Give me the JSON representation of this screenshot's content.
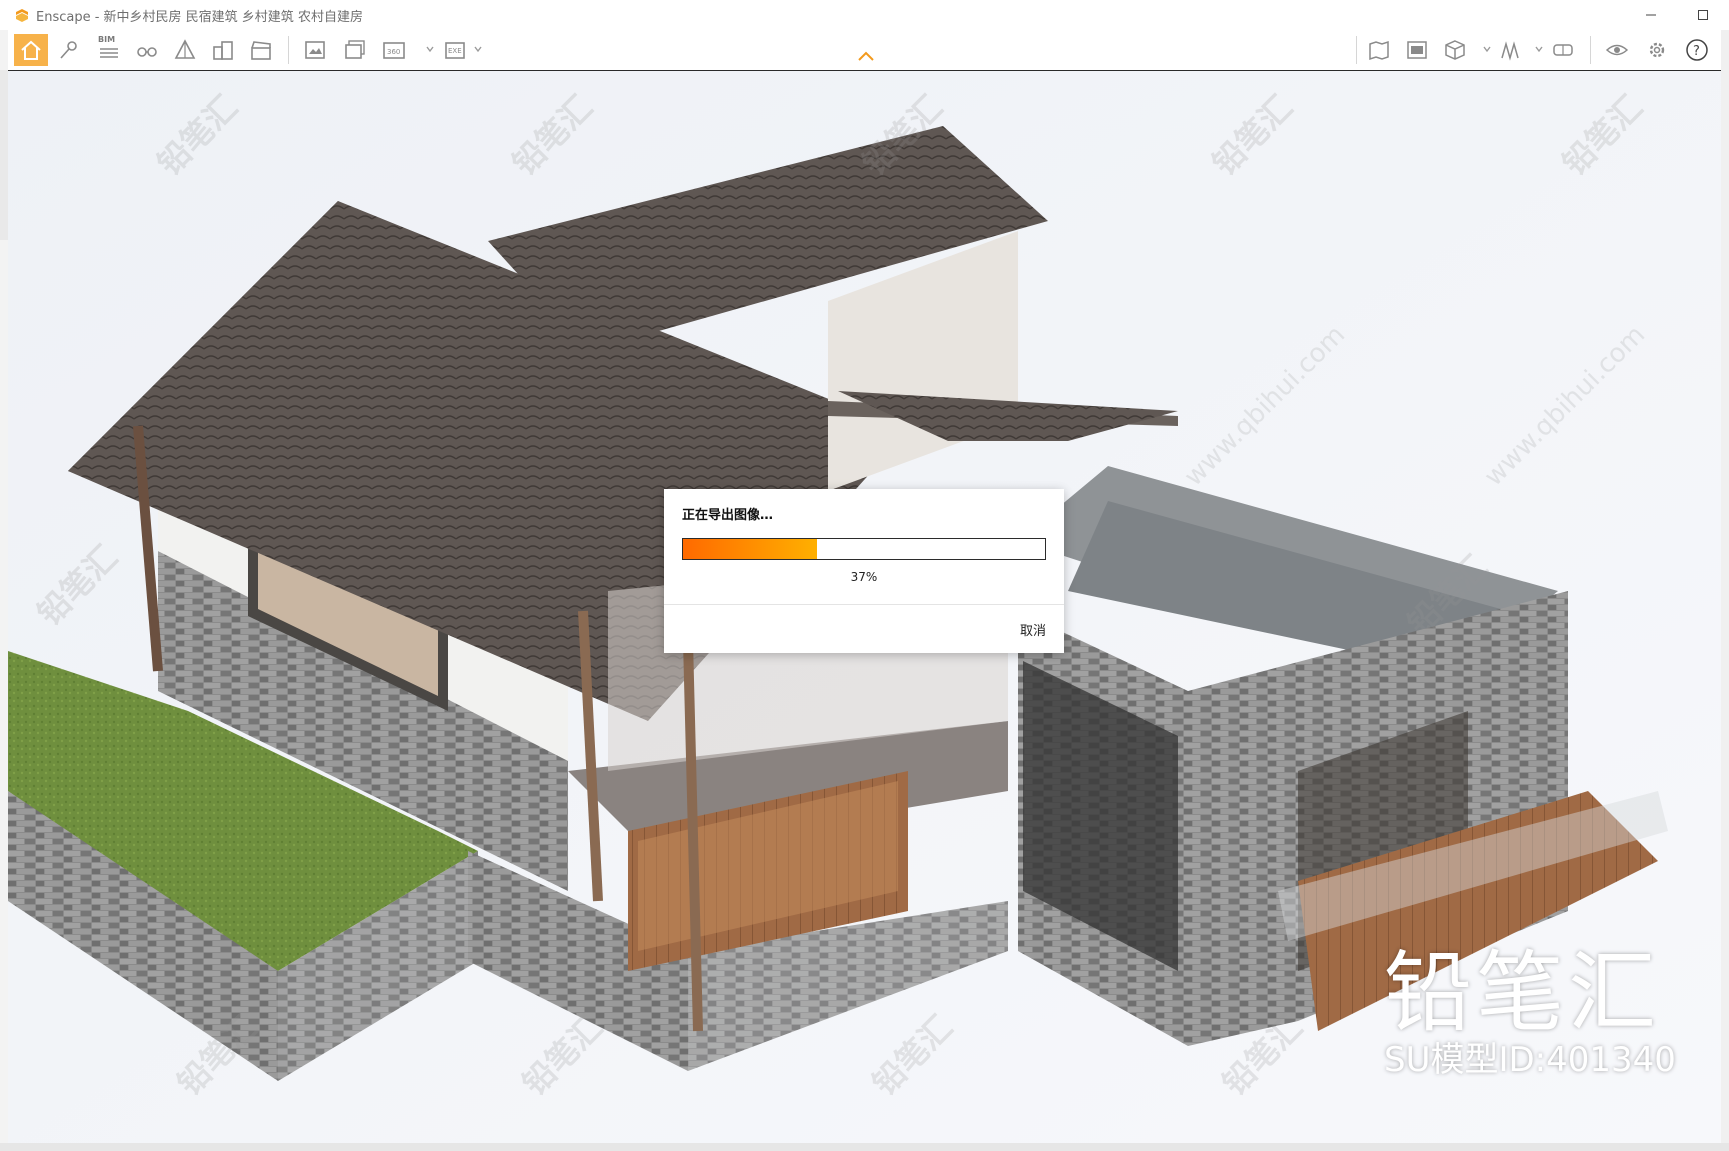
{
  "window": {
    "title": "Enscape - 新中乡村民房 民宿建筑 乡村建筑 农村自建房",
    "logo_icon": "enscape-logo-icon",
    "controls": [
      "minimize-icon",
      "maximize-icon"
    ]
  },
  "toolbar": {
    "accent_color": "#f7b24a",
    "left_icons": [
      "home-icon",
      "pin-icon",
      "bim-icon",
      "binoculars-icon",
      "grid-icon",
      "buildings-icon",
      "clapper-icon",
      "screenshot-icon",
      "batch-render-icon",
      "panorama-360-icon",
      "exe-export-icon"
    ],
    "bim_label": "BIM",
    "right_icons": [
      "map-icon",
      "asset-library-icon",
      "cube-icon",
      "atlas-icon",
      "vr-headset-icon",
      "eye-icon",
      "gear-icon",
      "help-icon"
    ]
  },
  "dialog": {
    "title": "正在导出图像…",
    "progress_percent": 37,
    "progress_label": "37%",
    "cancel_label": "取消",
    "bar_colors": [
      "#ff6a00",
      "#ffb000"
    ]
  },
  "watermarks": {
    "brand": "铅笔汇",
    "url": "www.qbihui.com",
    "brand_large": "铅笔汇",
    "model_id": "SU模型ID:401340"
  }
}
